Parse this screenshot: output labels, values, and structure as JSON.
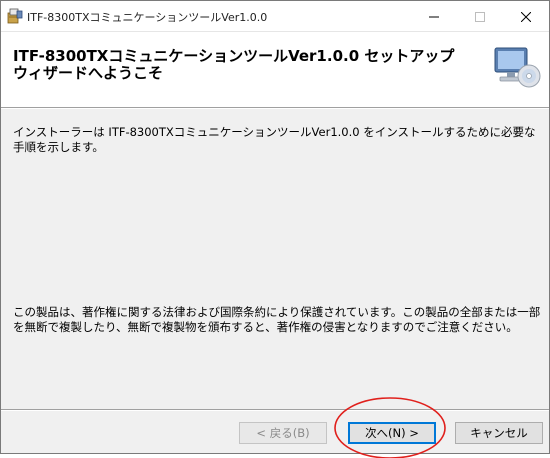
{
  "window": {
    "title": "ITF-8300TXコミュニケーションツールVer1.0.0",
    "icon": "installer-icon"
  },
  "titlebar_buttons": {
    "minimize_icon": "minimize-icon",
    "maximize_icon": "maximize-icon",
    "close_icon": "close-icon"
  },
  "header": {
    "title": "ITF-8300TXコミュニケーションツールVer1.0.0 セットアップ ウィザードへようこそ",
    "icon": "computer-cd-icon"
  },
  "body": {
    "intro": "インストーラーは ITF-8300TXコミュニケーションツールVer1.0.0 をインストールするために必要な手順を示します。",
    "copyright": "この製品は、著作権に関する法律および国際条約により保護されています。この製品の全部または一部を無断で複製したり、無断で複製物を頒布すると、著作権の侵害となりますのでご注意ください。"
  },
  "buttons": {
    "back_label": "< 戻る(B)",
    "next_label": "次へ(N) >",
    "cancel_label": "キャンセル"
  },
  "colors": {
    "focus_border": "#0078d7",
    "annotation_circle": "#e0201c"
  }
}
